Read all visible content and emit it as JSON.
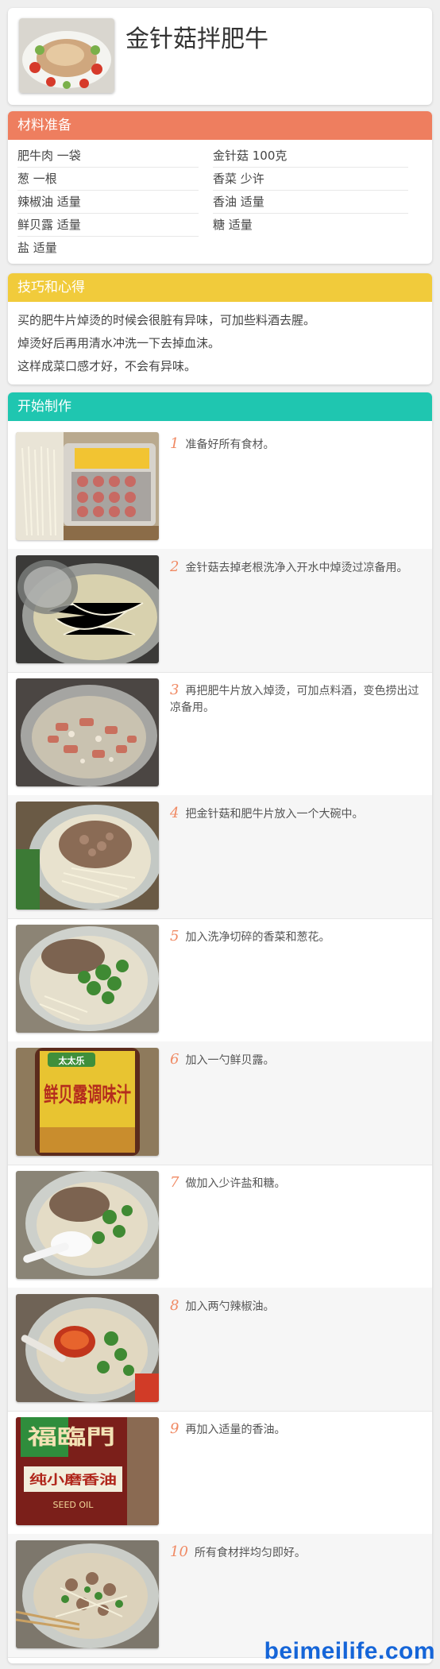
{
  "title": "金针菇拌肥牛",
  "colors": {
    "ingredients": "#ee7e5f",
    "tips": "#f1cb3b",
    "steps": "#1fc6b0",
    "step_number": "#f08a64",
    "watermark": "#1565d8"
  },
  "ingredients": {
    "header": "材料准备",
    "rows": [
      {
        "left": "肥牛肉  一袋",
        "right": "金针菇  100克"
      },
      {
        "left": "葱  一根",
        "right": "香菜  少许"
      },
      {
        "left": "辣椒油  适量",
        "right": "香油  适量"
      },
      {
        "left": "鲜贝露  适量",
        "right": "糖  适量"
      },
      {
        "left": "盐  适量",
        "right": ""
      }
    ]
  },
  "tips": {
    "header": "技巧和心得",
    "lines": [
      "买的肥牛片焯烫的时候会很脏有异味，可加些料酒去腥。",
      "焯烫好后再用清水冲洗一下去掉血沫。",
      "这样成菜口感才好，不会有异味。"
    ]
  },
  "steps": {
    "header": "开始制作",
    "items": [
      {
        "num": "1",
        "text": "准备好所有食材。",
        "photo": "ingredients-photo"
      },
      {
        "num": "2",
        "text": "金针菇去掉老根洗净入开水中焯烫过凉备用。",
        "photo": "blanch-mushroom-photo"
      },
      {
        "num": "3",
        "text": "再把肥牛片放入焯烫，可加点料酒，变色捞出过凉备用。",
        "photo": "blanch-beef-photo"
      },
      {
        "num": "4",
        "text": "把金针菇和肥牛片放入一个大碗中。",
        "photo": "bowl-photo"
      },
      {
        "num": "5",
        "text": "加入洗净切碎的香菜和葱花。",
        "photo": "herbs-photo"
      },
      {
        "num": "6",
        "text": "加入一勺鲜贝露。",
        "photo": "sauce-bottle-photo",
        "bottle_text": "鲜贝露调味汁",
        "bottle_brand": "太太乐"
      },
      {
        "num": "7",
        "text": "做加入少许盐和糖。",
        "photo": "salt-spoon-photo"
      },
      {
        "num": "8",
        "text": "加入两勺辣椒油。",
        "photo": "chili-oil-photo"
      },
      {
        "num": "9",
        "text": "再加入适量的香油。",
        "photo": "sesame-oil-photo",
        "bottle_text": "纯小磨香油",
        "bottle_brand": "福臨門",
        "bottle_sub": "SEED OIL"
      },
      {
        "num": "10",
        "text": "所有食材拌均匀即好。",
        "photo": "final-dish-photo"
      }
    ]
  },
  "watermark": "beimeilife.com"
}
